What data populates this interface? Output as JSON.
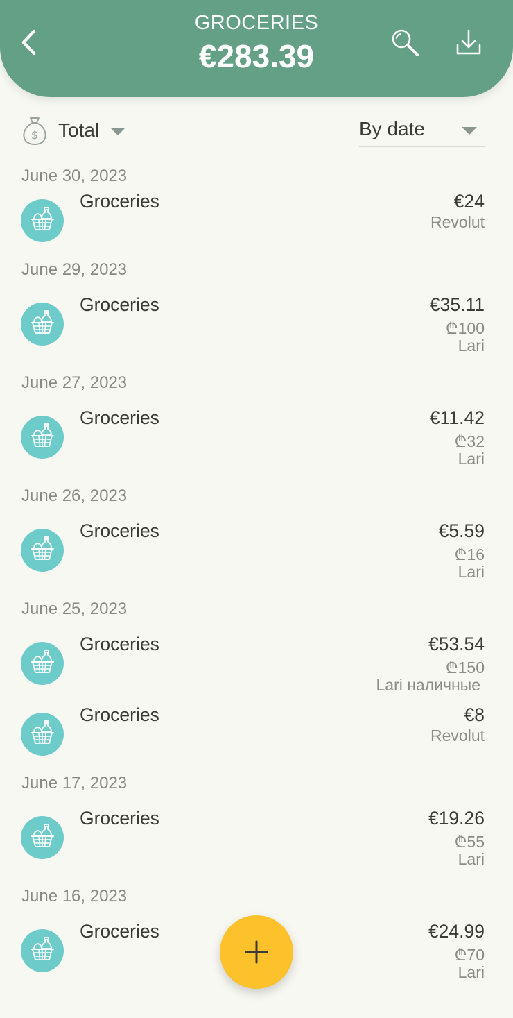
{
  "header": {
    "title": "GROCERIES",
    "amount": "€283.39",
    "back_icon": "chevron-left-icon",
    "search_icon": "search-icon",
    "download_icon": "download-icon",
    "color": "#63a086"
  },
  "filters": {
    "total_label": "Total",
    "total_icon": "money-bag-icon",
    "sort_label": "By date"
  },
  "groups": [
    {
      "date": "June 30, 2023",
      "items": [
        {
          "category": "Groceries",
          "amount": "€24",
          "sub1": "Revolut",
          "sub2": ""
        }
      ]
    },
    {
      "date": "June 29, 2023",
      "items": [
        {
          "category": "Groceries",
          "amount": "€35.11",
          "sub1": "₾100",
          "sub2": "Lari"
        }
      ]
    },
    {
      "date": "June 27, 2023",
      "items": [
        {
          "category": "Groceries",
          "amount": "€11.42",
          "sub1": "₾32",
          "sub2": "Lari"
        }
      ]
    },
    {
      "date": "June 26, 2023",
      "items": [
        {
          "category": "Groceries",
          "amount": "€5.59",
          "sub1": "₾16",
          "sub2": "Lari"
        }
      ]
    },
    {
      "date": "June 25, 2023",
      "items": [
        {
          "category": "Groceries",
          "amount": "€53.54",
          "sub1": "₾150",
          "sub2": "Lari наличные"
        },
        {
          "category": "Groceries",
          "amount": "€8",
          "sub1": "Revolut",
          "sub2": ""
        }
      ]
    },
    {
      "date": "June 17, 2023",
      "items": [
        {
          "category": "Groceries",
          "amount": "€19.26",
          "sub1": "₾55",
          "sub2": "Lari"
        }
      ]
    },
    {
      "date": "June 16, 2023",
      "items": [
        {
          "category": "Groceries",
          "amount": "€24.99",
          "sub1": "₾70",
          "sub2": "Lari"
        }
      ]
    }
  ],
  "category_icon": "grocery-basket-icon",
  "category_color": "#6dcbc9",
  "fab": {
    "icon": "plus-icon",
    "color": "#fdc12b"
  }
}
